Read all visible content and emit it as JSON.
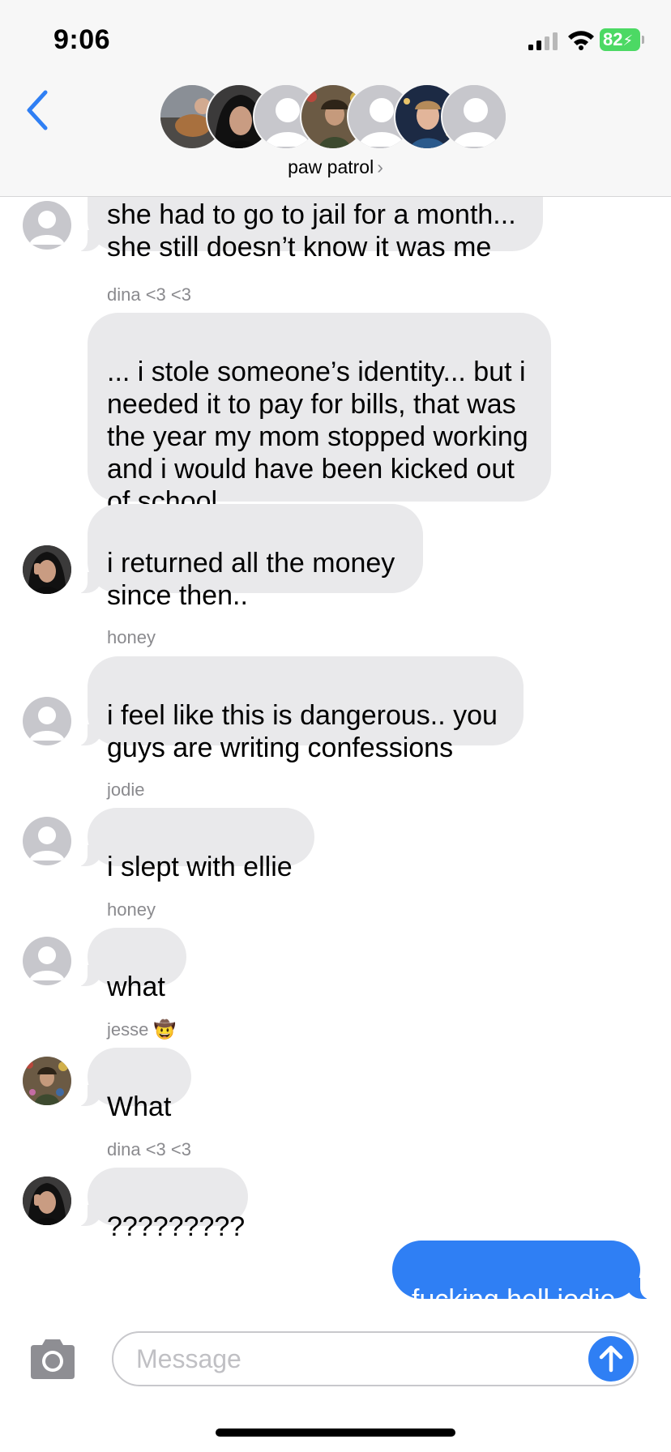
{
  "status_bar": {
    "time": "9:06",
    "battery": "82"
  },
  "header": {
    "group_name": "paw patrol",
    "chevron": "›",
    "avatar_count": 7
  },
  "messages": [
    {
      "sender": "",
      "text": "she had to go to jail for a month...\nshe still doesn’t know it was me",
      "avatar": "placeholder"
    },
    {
      "sender": "dina <3 <3",
      "text": "... i stole someone’s identity... but i needed it to pay for bills, that was the year my mom stopped working and i would have been kicked out of school"
    },
    {
      "sender": "",
      "text": "i returned all the money\nsince then..",
      "avatar": "photo-dina"
    },
    {
      "sender": "honey",
      "text": "i feel like this is dangerous.. you\nguys are writing confessions",
      "avatar": "placeholder"
    },
    {
      "sender": "jodie",
      "text": "i slept with ellie",
      "avatar": "placeholder"
    },
    {
      "sender": "honey",
      "text": "what",
      "avatar": "placeholder"
    },
    {
      "sender": "jesse 🤠",
      "text": "What",
      "avatar": "photo-jesse"
    },
    {
      "sender": "dina <3 <3",
      "text": "?????????",
      "avatar": "photo-dina"
    },
    {
      "sender": "me",
      "text": "fucking hell jodie"
    }
  ],
  "input": {
    "placeholder": "Message"
  },
  "colors": {
    "sent_bubble": "#2f7ff4",
    "received_bubble": "#e9e9eb",
    "accent": "#2f7ff4"
  }
}
